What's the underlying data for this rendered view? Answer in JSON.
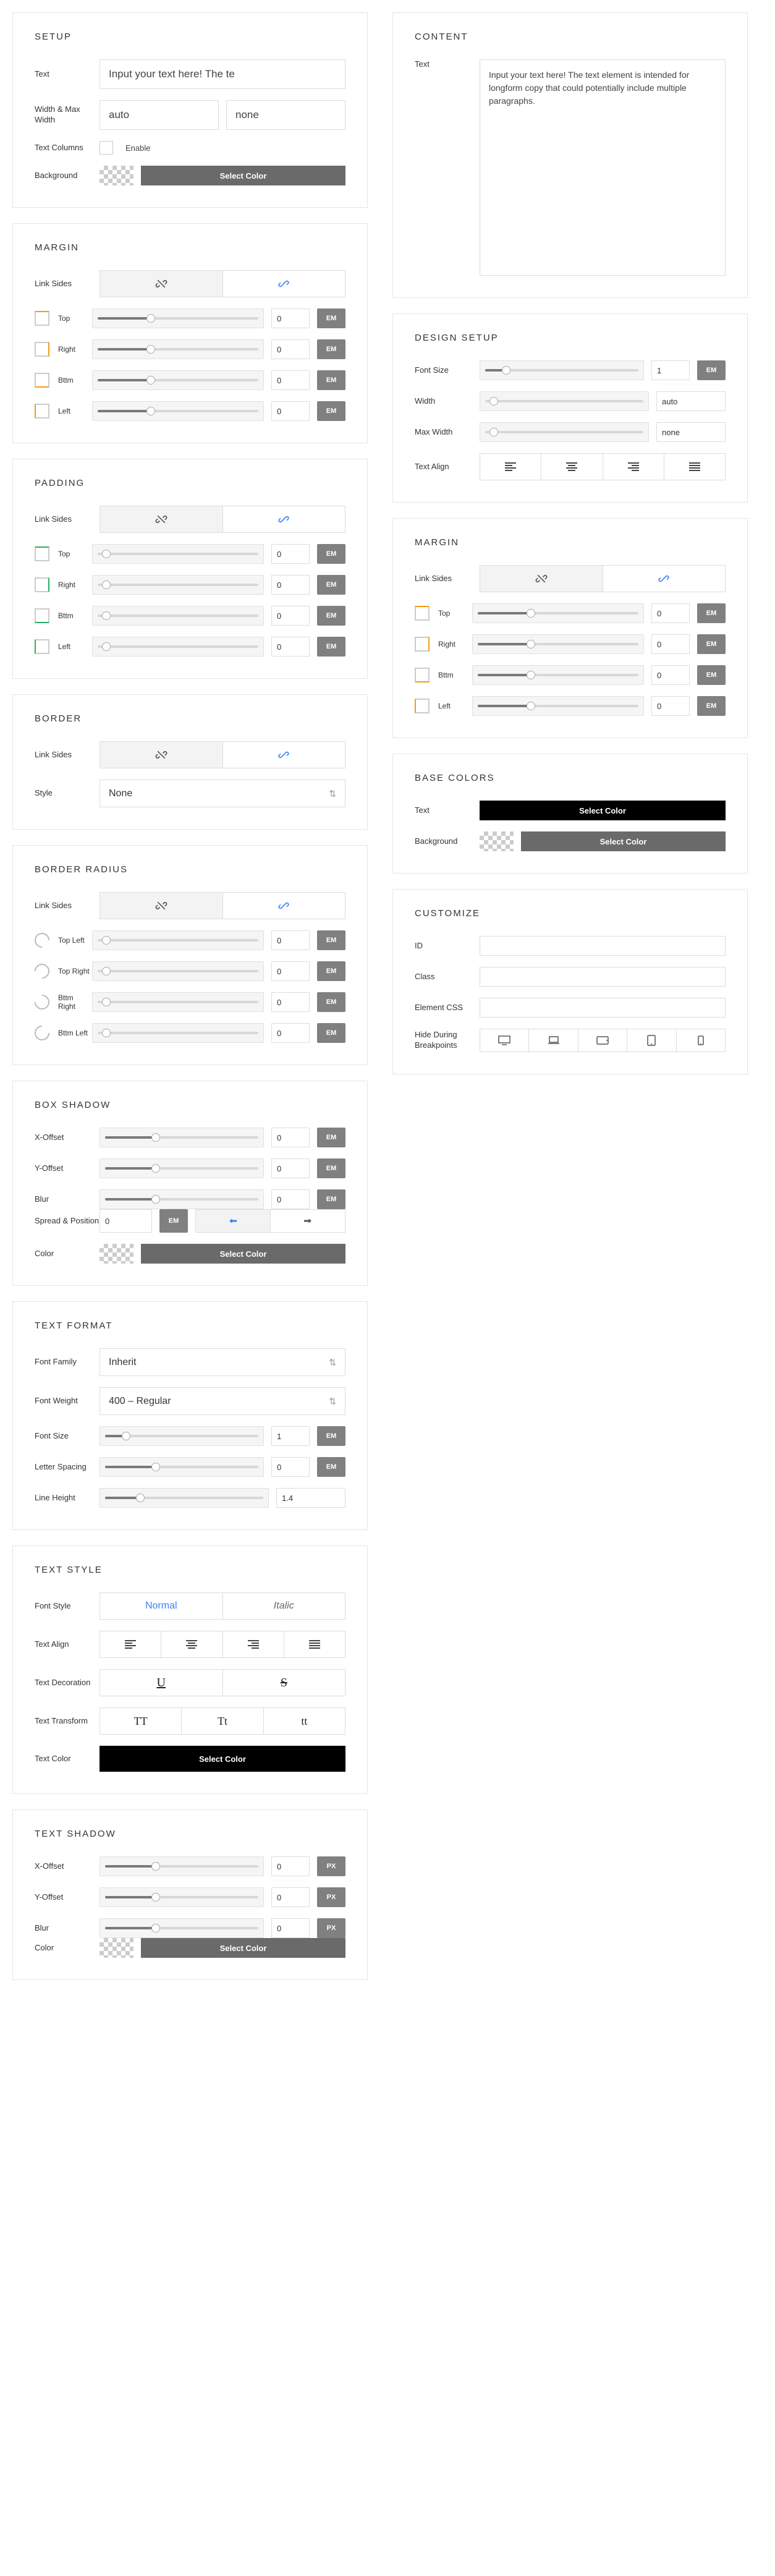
{
  "left": {
    "setup": {
      "title": "SETUP",
      "text_label": "Text",
      "text_value": "Input your text here! The te",
      "wmw_label": "Width & Max Width",
      "width_value": "auto",
      "maxwidth_value": "none",
      "textcols_label": "Text Columns",
      "enable_label": "Enable",
      "bg_label": "Background",
      "select_color": "Select Color"
    },
    "margin": {
      "title": "MARGIN",
      "linksides": "Link Sides",
      "sides": [
        "Top",
        "Right",
        "Bttm",
        "Left"
      ],
      "values": [
        "0",
        "0",
        "0",
        "0"
      ],
      "unit": "EM",
      "slider_fill": 30
    },
    "padding": {
      "title": "PADDING",
      "linksides": "Link Sides",
      "sides": [
        "Top",
        "Right",
        "Bttm",
        "Left"
      ],
      "values": [
        "0",
        "0",
        "0",
        "0"
      ],
      "unit": "EM"
    },
    "border": {
      "title": "BORDER",
      "linksides": "Link Sides",
      "style_label": "Style",
      "style_value": "None"
    },
    "radius": {
      "title": "BORDER RADIUS",
      "linksides": "Link Sides",
      "corners": [
        "Top Left",
        "Top Right",
        "Bttm Right",
        "Bttm Left"
      ],
      "values": [
        "0",
        "0",
        "0",
        "0"
      ],
      "unit": "EM"
    },
    "shadow": {
      "title": "BOX SHADOW",
      "xoff": "X-Offset",
      "yoff": "Y-Offset",
      "blur": "Blur",
      "spread": "Spread & Position",
      "spread_val": "0",
      "color_label": "Color",
      "values": [
        "0",
        "0",
        "0"
      ],
      "unit": "EM",
      "select_color": "Select Color"
    },
    "format": {
      "title": "TEXT FORMAT",
      "ff_label": "Font Family",
      "ff_value": "Inherit",
      "fw_label": "Font Weight",
      "fw_value": "400 – Regular",
      "fs_label": "Font Size",
      "fs_value": "1",
      "ls_label": "Letter Spacing",
      "ls_value": "0",
      "lh_label": "Line Height",
      "lh_value": "1.4",
      "unit": "EM"
    },
    "style": {
      "title": "TEXT STYLE",
      "fontstyle_label": "Font Style",
      "normal": "Normal",
      "italic": "Italic",
      "align_label": "Text Align",
      "deco_label": "Text Decoration",
      "transform_label": "Text Transform",
      "color_label": "Text Color",
      "select_color": "Select Color",
      "u": "U",
      "s": "S",
      "tt1": "TT",
      "tt2": "Tt",
      "tt3": "tt"
    },
    "tshadow": {
      "title": "TEXT SHADOW",
      "xoff": "X-Offset",
      "yoff": "Y-Offset",
      "blur": "Blur",
      "color_label": "Color",
      "values": [
        "0",
        "0",
        "0"
      ],
      "unit": "PX",
      "select_color": "Select Color"
    }
  },
  "right": {
    "content": {
      "title": "CONTENT",
      "text_label": "Text",
      "text_value": "Input your text here! The text element is intended for longform copy that could potentially include multiple paragraphs."
    },
    "design": {
      "title": "DESIGN SETUP",
      "fs_label": "Font Size",
      "fs_value": "1",
      "fs_unit": "EM",
      "w_label": "Width",
      "w_value": "auto",
      "mw_label": "Max Width",
      "mw_value": "none",
      "align_label": "Text Align"
    },
    "margin": {
      "title": "MARGIN",
      "linksides": "Link Sides",
      "sides": [
        "Top",
        "Right",
        "Bttm",
        "Left"
      ],
      "values": [
        "0",
        "0",
        "0",
        "0"
      ],
      "unit": "EM",
      "slider_fill": 30
    },
    "colors": {
      "title": "BASE COLORS",
      "text_label": "Text",
      "bg_label": "Background",
      "select_color": "Select Color"
    },
    "customize": {
      "title": "CUSTOMIZE",
      "id_label": "ID",
      "class_label": "Class",
      "css_label": "Element CSS",
      "bp_label": "Hide During Breakpoints"
    }
  }
}
